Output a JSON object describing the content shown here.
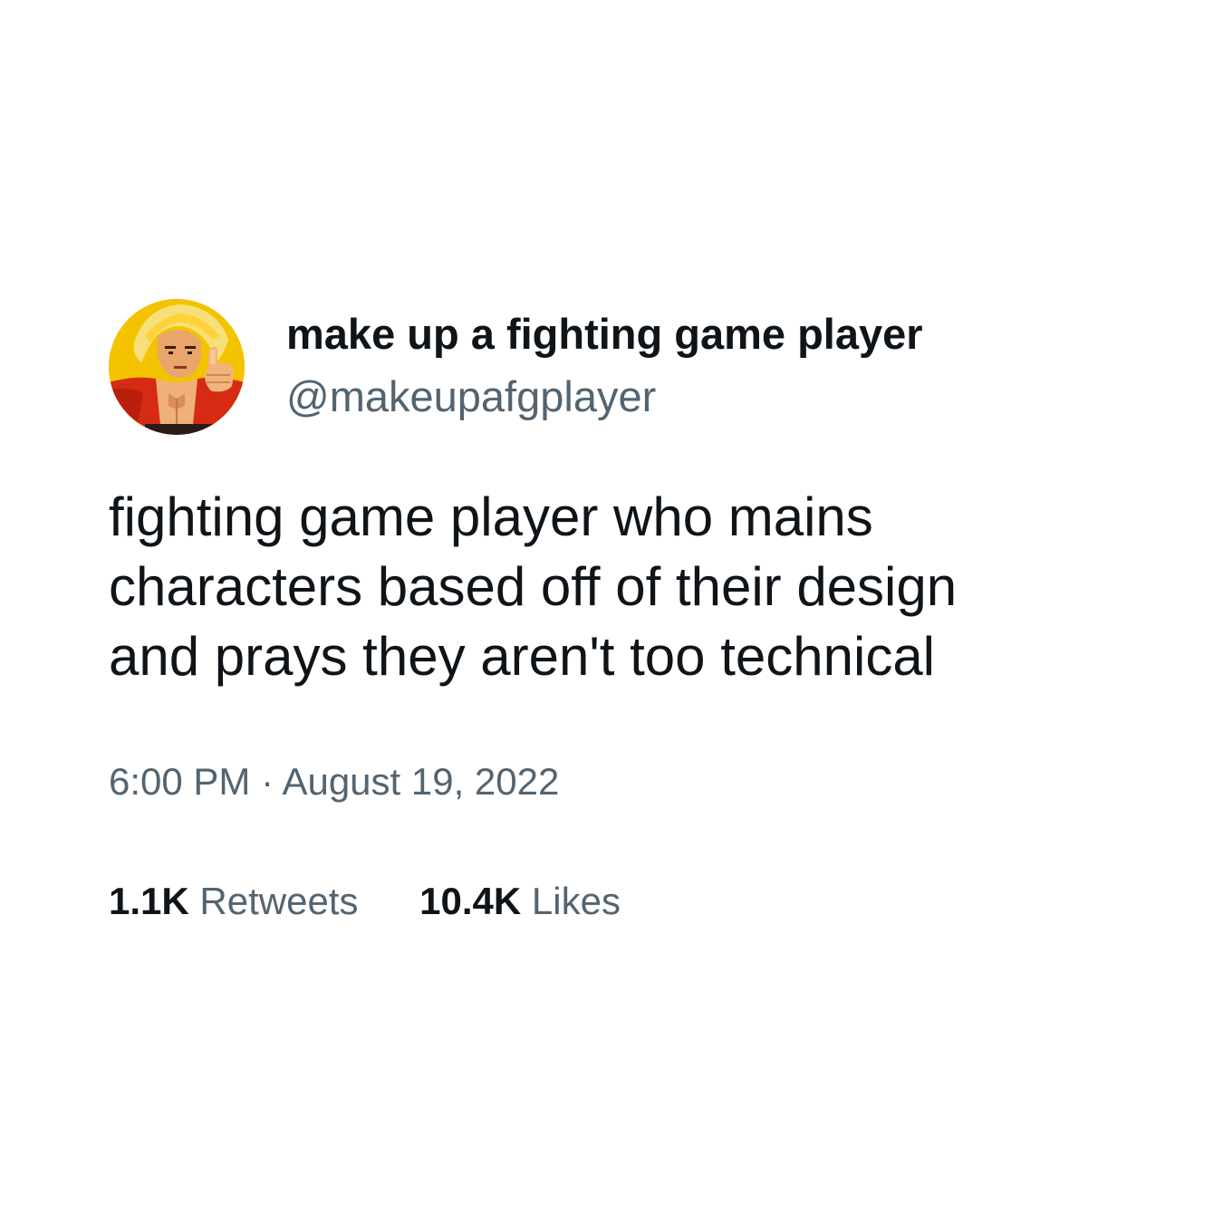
{
  "user": {
    "display_name": "make up a fighting game player",
    "handle": "@makeupafgplayer",
    "avatar_icon": "fighter-avatar"
  },
  "tweet": {
    "lines": [
      "fighting game player who mains",
      "characters based off of their design",
      "and prays they aren't too technical"
    ],
    "time": "6:00 PM",
    "separator": "·",
    "date": "August 19, 2022"
  },
  "stats": {
    "retweets_count": "1.1K",
    "retweets_label": "Retweets",
    "likes_count": "10.4K",
    "likes_label": "Likes"
  },
  "colors": {
    "text_primary": "#0f1419",
    "text_secondary": "#536471",
    "background": "#ffffff"
  }
}
